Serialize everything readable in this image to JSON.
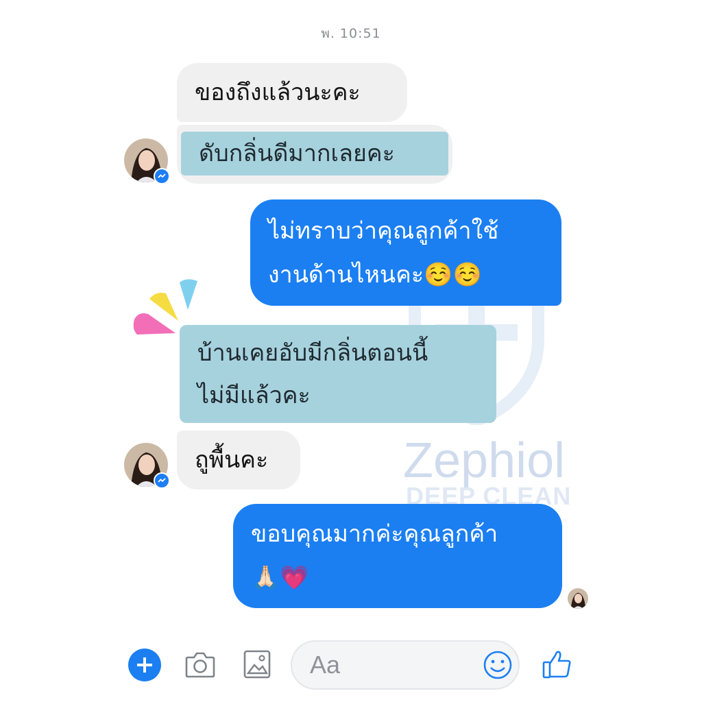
{
  "timestamp": "พ. 10:51",
  "watermark": {
    "brand": "Zephiol",
    "tagline": "DEEP CLEAN"
  },
  "messages": [
    {
      "side": "incoming",
      "style": "grey",
      "lines": [
        "ของถึงแล้วนะคะ"
      ]
    },
    {
      "side": "incoming",
      "style": "teal",
      "lines": [
        "ดับกลิ่นดีมากเลยคะ"
      ]
    },
    {
      "side": "outgoing",
      "style": "blue",
      "lines": [
        "ไม่ทราบว่าคุณลูกค้าใช้",
        "งานด้านไหนคะ☺️☺️"
      ]
    },
    {
      "side": "incoming",
      "style": "teal",
      "lines": [
        "บ้านเคยอับมีกลิ่นตอนนี้",
        "ไม่มีแล้วคะ"
      ]
    },
    {
      "side": "incoming",
      "style": "grey",
      "lines": [
        "ถูพื้นคะ"
      ]
    },
    {
      "side": "outgoing",
      "style": "blue",
      "lines": [
        "ขอบคุณมากค่ะคุณลูกค้า",
        "🙏🏻💗"
      ]
    }
  ],
  "composer": {
    "placeholder": "Aa",
    "icons": [
      "plus-icon",
      "camera-icon",
      "image-icon",
      "emoji-icon",
      "thumbs-up-icon"
    ]
  },
  "colors": {
    "outgoing_bubble": "#1b7ff2",
    "incoming_bubble": "#f1f0f0",
    "highlight_bubble": "#a6d2de",
    "accent": "#1b7ff2"
  }
}
